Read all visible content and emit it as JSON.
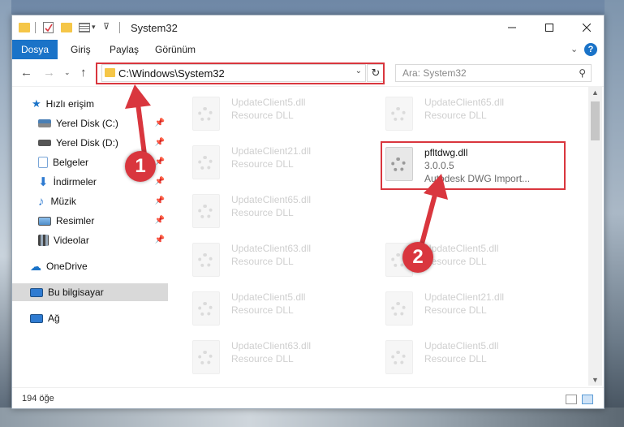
{
  "window": {
    "title": "System32"
  },
  "ribbon": {
    "tabs": [
      {
        "label": "Dosya"
      },
      {
        "label": "Giriş"
      },
      {
        "label": "Paylaş"
      },
      {
        "label": "Görünüm"
      }
    ],
    "help": "?"
  },
  "navigation": {
    "address": "C:\\Windows\\System32",
    "search_placeholder": "Ara: System32"
  },
  "sidebar": {
    "items": [
      {
        "label": "Hızlı erişim",
        "icon": "star-icon",
        "color": "#1a73c8"
      },
      {
        "label": "Yerel Disk (C:)",
        "icon": "drive-c-icon",
        "color": "#4a7fb5"
      },
      {
        "label": "Yerel Disk (D:)",
        "icon": "drive-d-icon",
        "color": "#555555"
      },
      {
        "label": "Belgeler",
        "icon": "documents-icon",
        "color": "#7aa6d8"
      },
      {
        "label": "İndirmeler",
        "icon": "downloads-icon",
        "color": "#2f7bd1"
      },
      {
        "label": "Müzik",
        "icon": "music-icon",
        "color": "#2f7bd1"
      },
      {
        "label": "Resimler",
        "icon": "pictures-icon",
        "color": "#4f8ec9"
      },
      {
        "label": "Videolar",
        "icon": "videos-icon",
        "color": "#444444"
      },
      {
        "label": "OneDrive",
        "icon": "onedrive-icon",
        "color": "#1a73c8"
      },
      {
        "label": "Bu bilgisayar",
        "icon": "computer-icon",
        "color": "#2f7bd1"
      },
      {
        "label": "Ağ",
        "icon": "network-icon",
        "color": "#2f7bd1"
      }
    ]
  },
  "files": {
    "left_col": [
      {
        "name": "UpdateClient5.dll",
        "sub": "Resource DLL"
      },
      {
        "name": "UpdateClient21.dll",
        "sub": "Resource DLL"
      },
      {
        "name": "UpdateClient65.dll",
        "sub": "Resource DLL"
      },
      {
        "name": "UpdateClient63.dll",
        "sub": "Resource DLL"
      },
      {
        "name": "UpdateClient5.dll",
        "sub": "Resource DLL"
      },
      {
        "name": "UpdateClient63.dll",
        "sub": "Resource DLL"
      }
    ],
    "right_col": [
      {
        "name": "UpdateClient65.dll",
        "sub": "Resource DLL"
      },
      {
        "name": "pfltdwg.dll",
        "version": "3.0.0.5",
        "description": "Autodesk DWG Import..."
      },
      {
        "name": "UpdateClient5.dll",
        "sub": "Resource DLL"
      },
      {
        "name": "UpdateClient21.dll",
        "sub": "Resource DLL"
      },
      {
        "name": "UpdateClient5.dll",
        "sub": "Resource DLL"
      }
    ]
  },
  "status": {
    "count": "194 öğe"
  },
  "callouts": {
    "one": "1",
    "two": "2"
  },
  "colors": {
    "accent": "#1a73c8",
    "highlight": "#d9363e"
  }
}
